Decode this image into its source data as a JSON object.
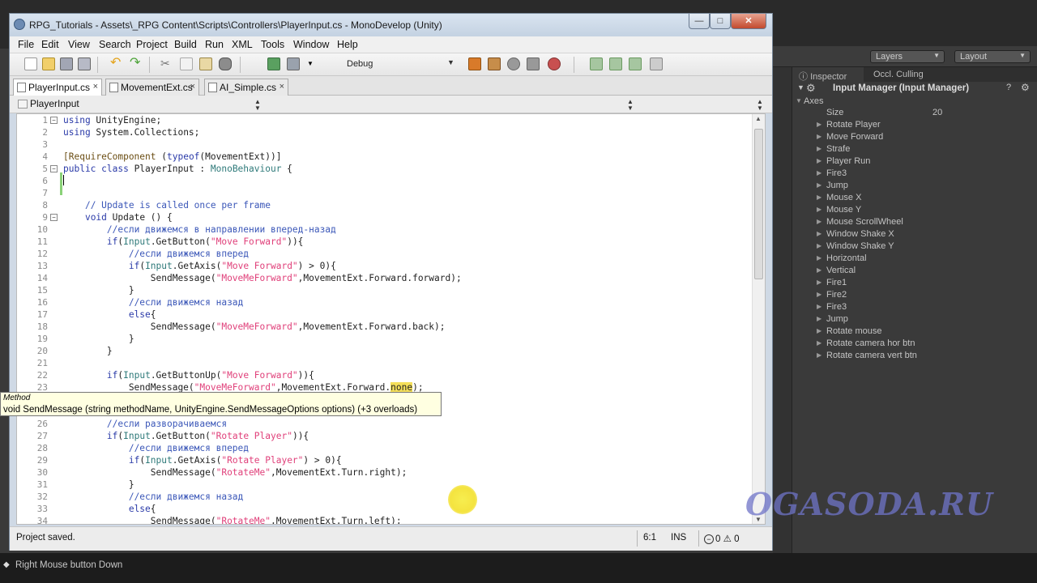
{
  "window": {
    "title": "RPG_Tutorials - Assets\\_RPG Content\\Scripts\\Controllers\\PlayerInput.cs - MonoDevelop (Unity)",
    "min": "—",
    "max": "□",
    "close": "✕"
  },
  "menu": [
    "File",
    "Edit",
    "View",
    "Search",
    "Project",
    "Build",
    "Run",
    "XML",
    "Tools",
    "Window",
    "Help"
  ],
  "toolbar": {
    "configuration": "Debug"
  },
  "tabs": [
    {
      "label": "PlayerInput.cs",
      "close": "×"
    },
    {
      "label": "MovementExt.cs",
      "close": "×"
    },
    {
      "label": "AI_Simple.cs",
      "close": "×"
    }
  ],
  "pathbar": {
    "class_combo": "PlayerInput"
  },
  "editor": {
    "line_numbers": [
      "1",
      "2",
      "3",
      "4",
      "5",
      "6",
      "7",
      "8",
      "9",
      "10",
      "11",
      "12",
      "13",
      "14",
      "15",
      "16",
      "17",
      "18",
      "19",
      "20",
      "21",
      "22",
      "23",
      "24",
      "25",
      "26",
      "27",
      "28",
      "29",
      "30",
      "31",
      "32",
      "33",
      "34"
    ],
    "tooltip_kind": "Method",
    "tooltip_signature": "void SendMessage (string methodName, UnityEngine.SendMessageOptions options) (+3 overloads)"
  },
  "status": {
    "message": "Project saved.",
    "position": "6:1",
    "mode": "INS",
    "errors": "0",
    "warnings": "0"
  },
  "unity": {
    "layers": "Layers",
    "layout": "Layout",
    "inspector_tab": "Inspector",
    "occlusion_tab": "Occl. Culling",
    "component_title": "Input Manager (Input Manager)",
    "axes_label": "Axes",
    "size_label": "Size",
    "size_value": "20",
    "axes": [
      "Rotate Player",
      "Move Forward",
      "Strafe",
      "Player Run",
      "Fire3",
      "Jump",
      "Mouse X",
      "Mouse Y",
      "Mouse ScrollWheel",
      "Window Shake X",
      "Window Shake Y",
      "Horizontal",
      "Vertical",
      "Fire1",
      "Fire2",
      "Fire3",
      "Jump",
      "Rotate mouse",
      "Rotate camera hor btn",
      "Rotate camera vert btn"
    ],
    "status": "Right Mouse button Down"
  },
  "watermark": "OGASODA.RU",
  "colors": {
    "keyword": "#2a3aa8",
    "string": "#e0407a",
    "comment": "#3b57b8",
    "highlight": "#f4df5a"
  }
}
